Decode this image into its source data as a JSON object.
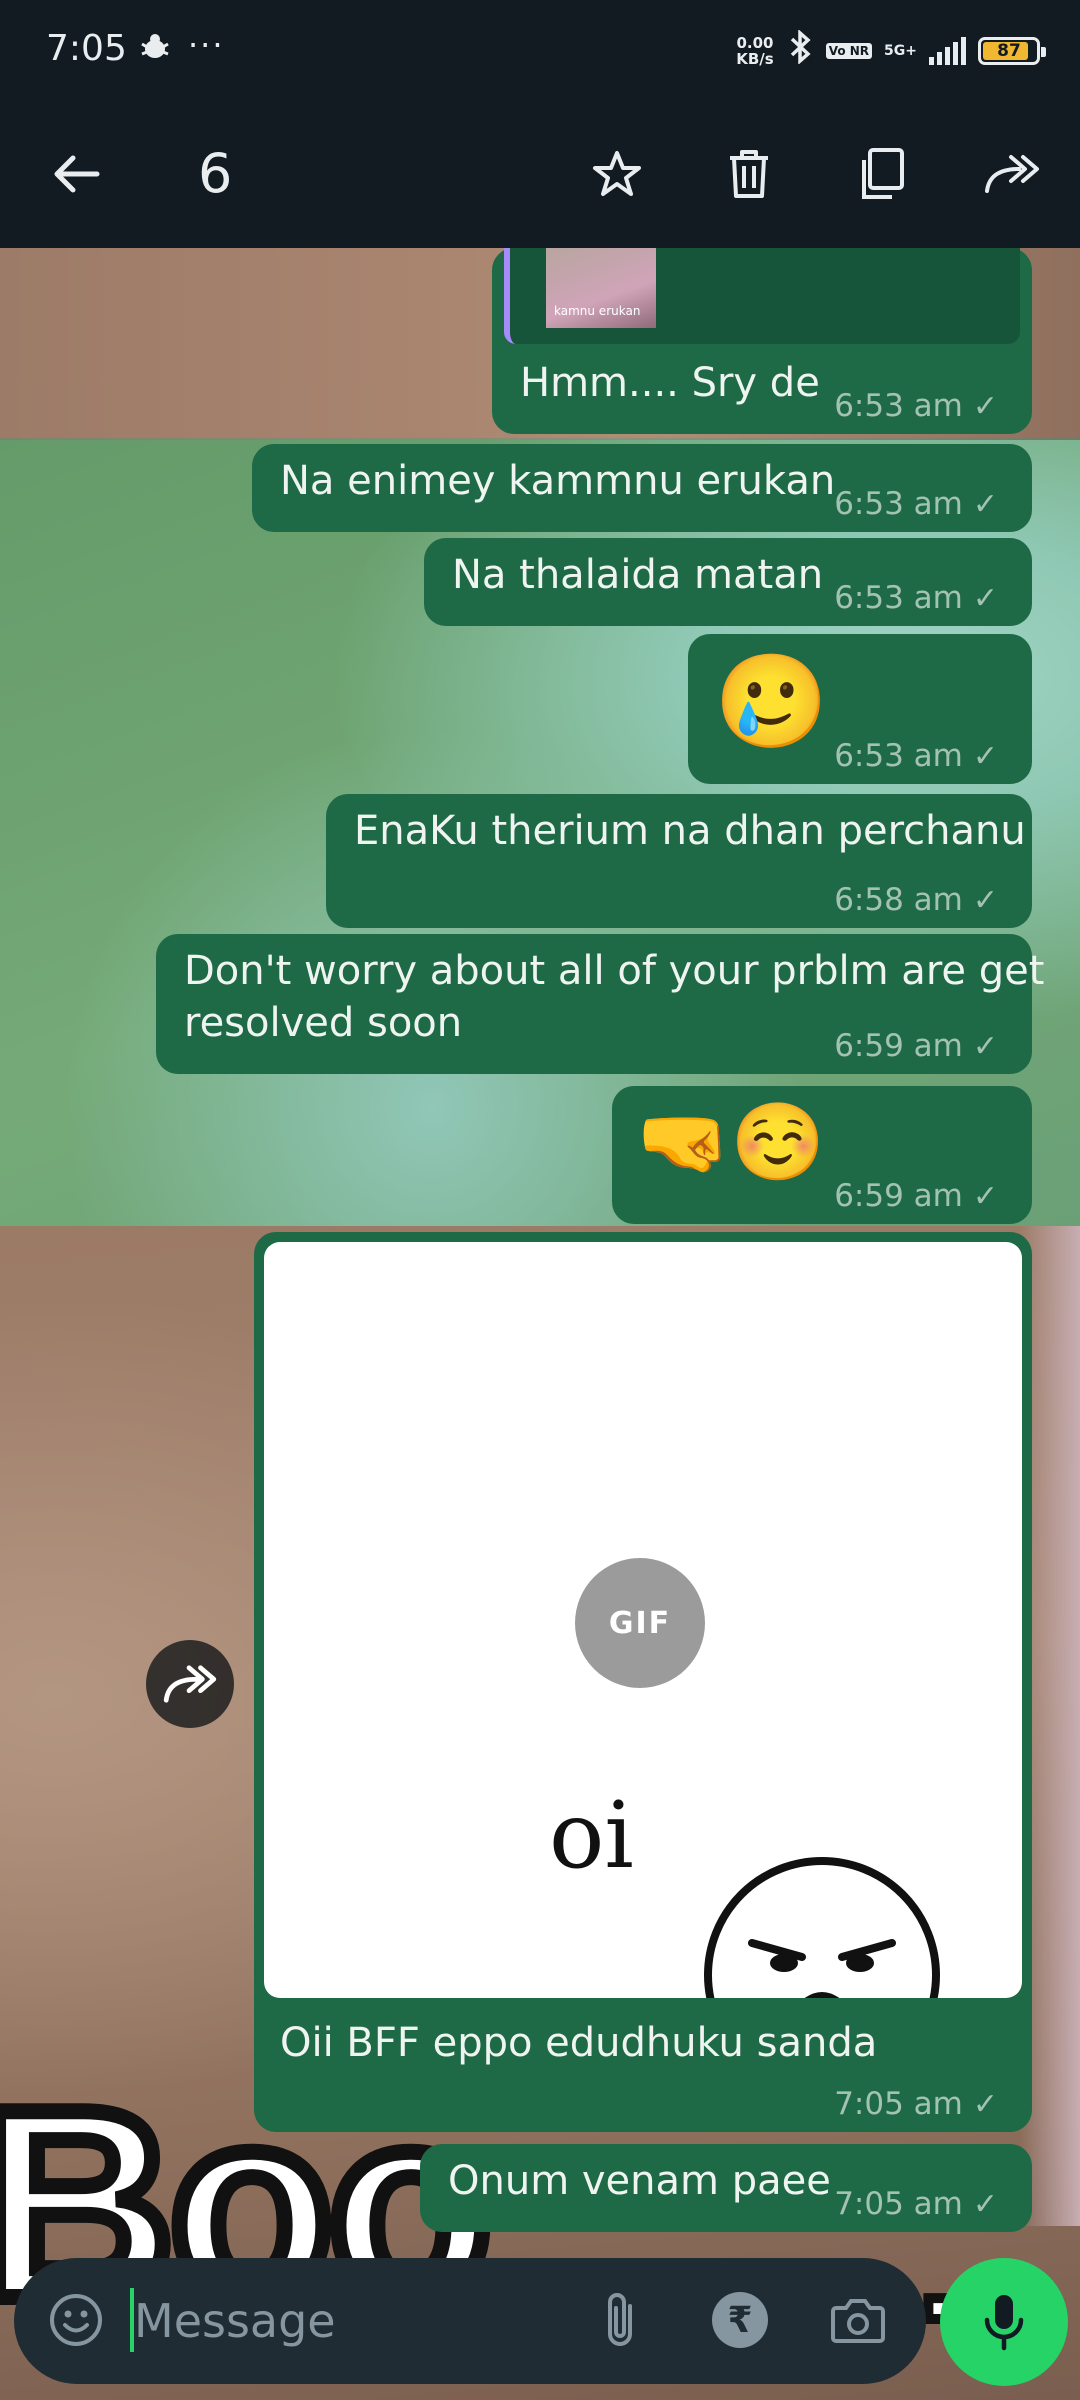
{
  "status_bar": {
    "time": "7:05",
    "more": "···",
    "speed_value": "0.00",
    "speed_unit": "KB/s",
    "volte": "Vo NR",
    "network": "5G+",
    "battery": "87",
    "battery_percent": 87
  },
  "action_bar": {
    "selected_count": "6",
    "icons": [
      "back-arrow-icon",
      "star-icon",
      "delete-icon",
      "copy-icon",
      "forward-icon"
    ]
  },
  "messages": [
    {
      "text": "Hmm.... Sry de",
      "time": "6:53 am",
      "quoted_caption": "kamnu erukan",
      "selected": false
    },
    {
      "text": "Na enimey kammnu erukan",
      "time": "6:53 am",
      "selected": true
    },
    {
      "text": "Na thalaida matan",
      "time": "6:53 am",
      "selected": true
    },
    {
      "text": "🥲",
      "time": "6:53 am",
      "selected": true
    },
    {
      "text": "EnaKu therium na dhan perchanu",
      "time": "6:58 am",
      "selected": true
    },
    {
      "text_line1": "Don't worry about all of your prblm are get",
      "text_line2": "resolved soon",
      "time": "6:59 am",
      "selected": true
    },
    {
      "text": "🤜☺️",
      "time": "6:59 am",
      "selected": true
    },
    {
      "gif_badge": "GIF",
      "gif_text": "oi",
      "caption": "Oii BFF eppo edudhuku sanda",
      "time": "7:05 am",
      "selected": false
    },
    {
      "text": "Onum venam paee",
      "time": "7:05 am",
      "selected": false
    }
  ],
  "wallpaper": {
    "big_text": "Boo",
    "dots": "...."
  },
  "input_bar": {
    "placeholder": "Message",
    "value": "",
    "rupee": "₹"
  },
  "colors": {
    "outgoing_bubble": "#1e6a47",
    "header": "#111b21",
    "accent": "#25d366",
    "selection_overlay": "rgba(24,160,140,0.25)"
  }
}
